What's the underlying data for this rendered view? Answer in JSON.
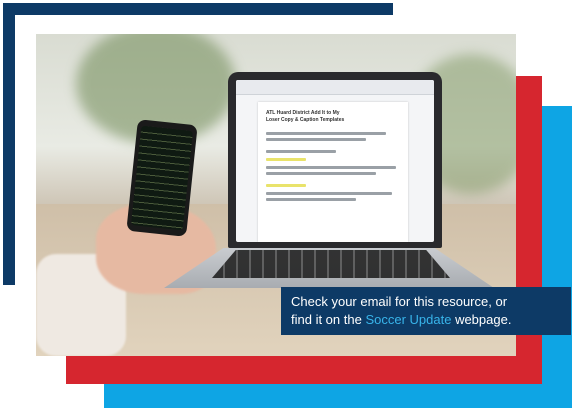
{
  "caption": {
    "line1": "Check your email for this resource, or",
    "line2_prefix": "find it on the ",
    "link_text": "Soccer Update",
    "line2_suffix": " webpage."
  },
  "document": {
    "title_line1": "ATL Huard District Add It to My",
    "title_line2": "Loser Copy & Caption Templates"
  },
  "colors": {
    "navy": "#0d3a66",
    "red": "#d6262f",
    "blue": "#0ea5e4",
    "link": "#38b4ea"
  }
}
